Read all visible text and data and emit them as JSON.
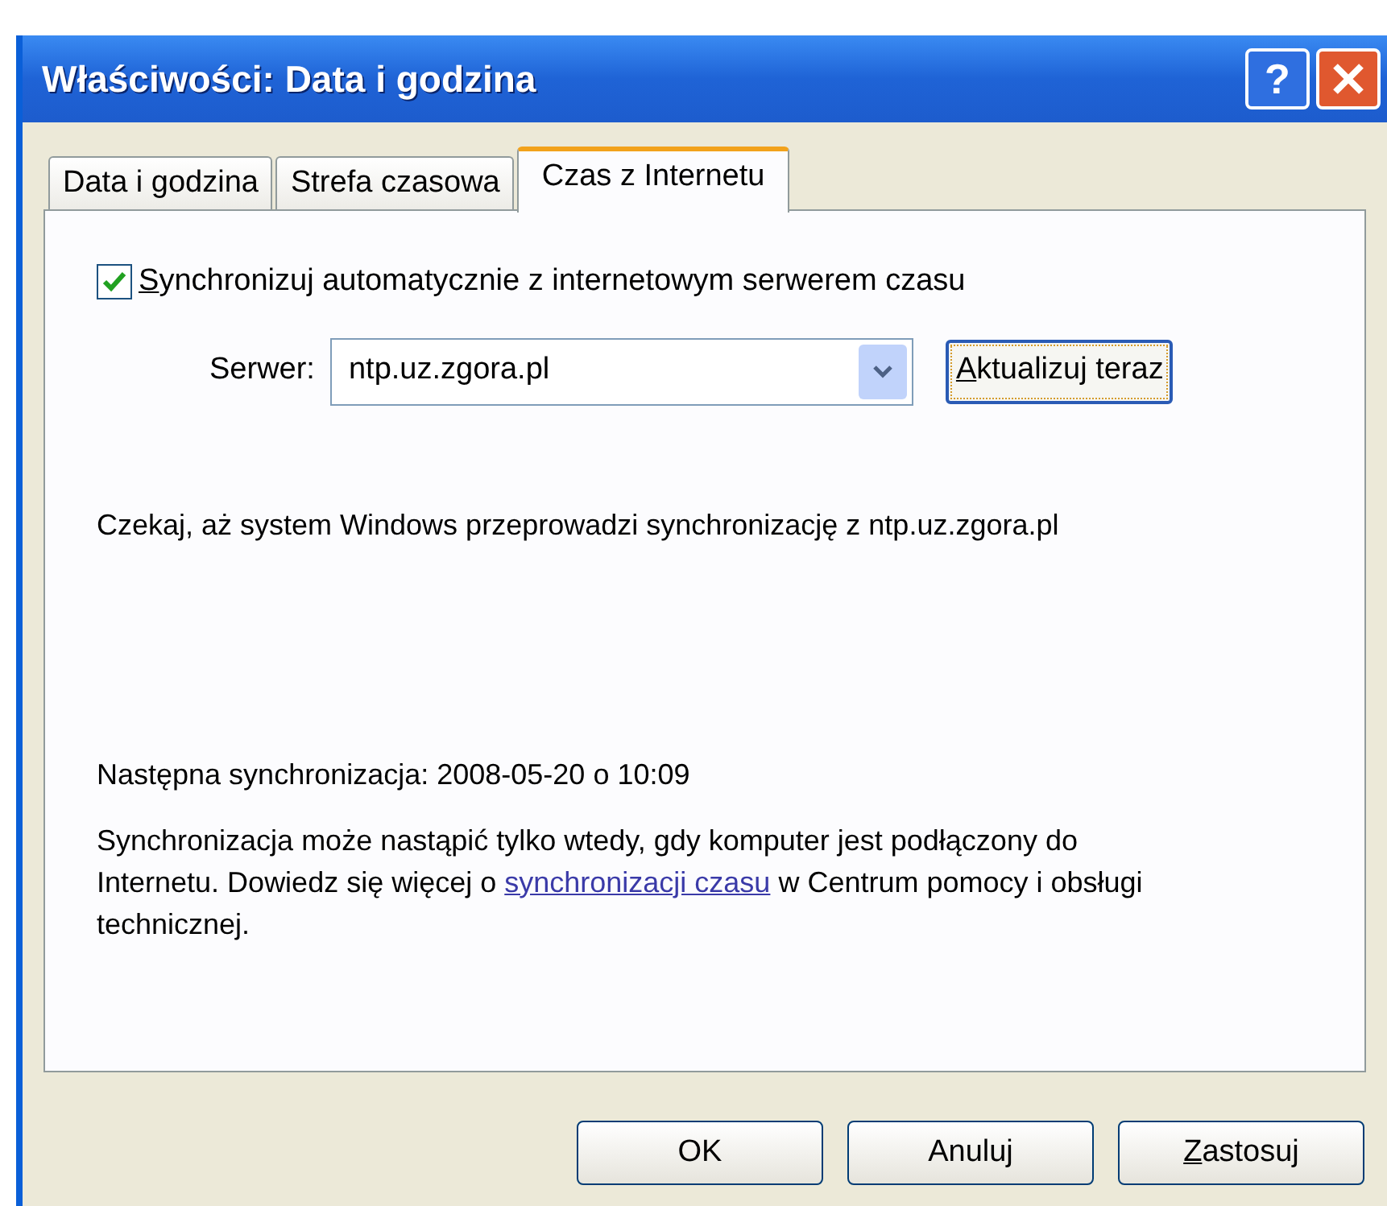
{
  "window": {
    "title": "Właściwości: Data i godzina",
    "help_button": "?"
  },
  "tabs": [
    {
      "label": "Data i godzina",
      "selected": false
    },
    {
      "label": "Strefa czasowa",
      "selected": false
    },
    {
      "label": "Czas z Internetu",
      "selected": true
    }
  ],
  "sync_checkbox": {
    "label": "Synchronizuj automatycznie z internetowym serwerem czasu",
    "checked": true,
    "underline_first": true
  },
  "server": {
    "label": "Serwer:",
    "value": "ntp.uz.zgora.pl"
  },
  "update_button": {
    "label": "Aktualizuj teraz",
    "underline_first": true,
    "focused": true
  },
  "status_text": "Czekaj, aż system Windows przeprowadzi synchronizację z ntp.uz.zgora.pl",
  "next_sync": "Następna synchronizacja: 2008-05-20 o 10:09",
  "info": {
    "before": "Synchronizacja może nastąpić tylko wtedy, gdy komputer jest podłączony do Internetu. Dowiedz się więcej o",
    "link": "synchronizacji czasu",
    "after": "w Centrum pomocy i obsługi technicznej."
  },
  "buttons": [
    {
      "label": "OK",
      "underline_first": false
    },
    {
      "label": "Anuluj",
      "underline_first": false
    },
    {
      "label": "Zastosuj",
      "underline_first": true
    }
  ]
}
